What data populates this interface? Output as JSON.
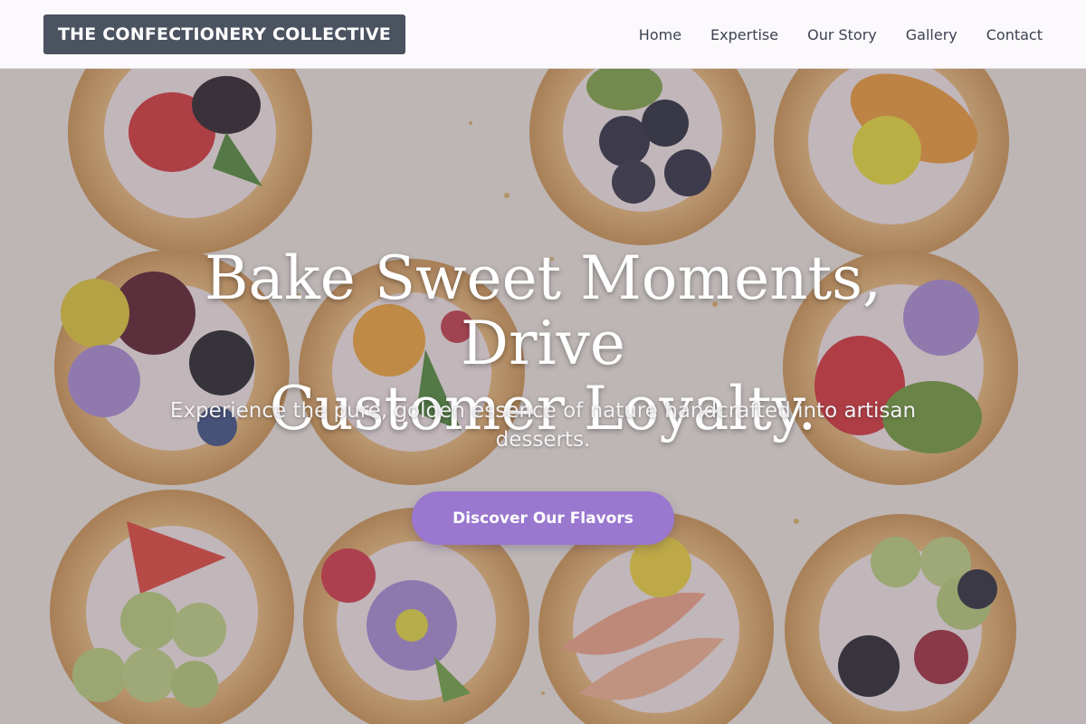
{
  "nav": {
    "brand": "THE CONFECTIONERY COLLECTIVE",
    "links": [
      "Home",
      "Expertise",
      "Our Story",
      "Gallery",
      "Contact"
    ]
  },
  "hero": {
    "title_line1": "Bake Sweet Moments, Drive",
    "title_line2": "Customer Loyalty.",
    "subtitle": "Experience the pure, golden essence of nature handcrafted into artisan desserts.",
    "cta_label": "Discover Our Flavors"
  },
  "colors": {
    "brand_bg": "#4b5260",
    "cta_bg": "#9a78cf",
    "nav_bg": "#fcf9fc",
    "nav_text": "#3c4251"
  }
}
